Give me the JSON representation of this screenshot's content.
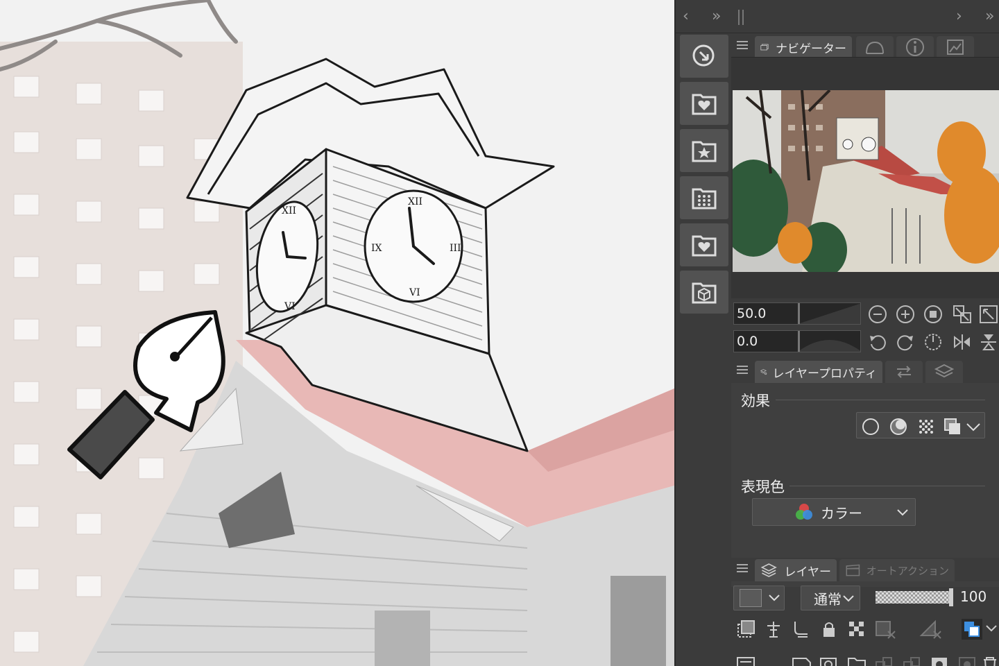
{
  "top_bar": {
    "left_arrow": "‹",
    "double_arrow": "»",
    "right_arrow": "›",
    "right_double_arrow": "»"
  },
  "navigator": {
    "tab_label": "ナビゲーター",
    "zoom_value": "50.0",
    "rotate_value": "0.0"
  },
  "layer_property": {
    "tab_label": "レイヤープロパティ",
    "effect_label": "効果",
    "expression_color_label": "表現色",
    "expression_color_value": "カラー"
  },
  "layer": {
    "tab_label": "レイヤー",
    "auto_action_tab_label": "オートアクション",
    "blend_mode": "通常",
    "opacity": "100"
  },
  "colors": {
    "panel_bg": "#3b3b3b",
    "accent_blue": "#3d8fe0"
  }
}
